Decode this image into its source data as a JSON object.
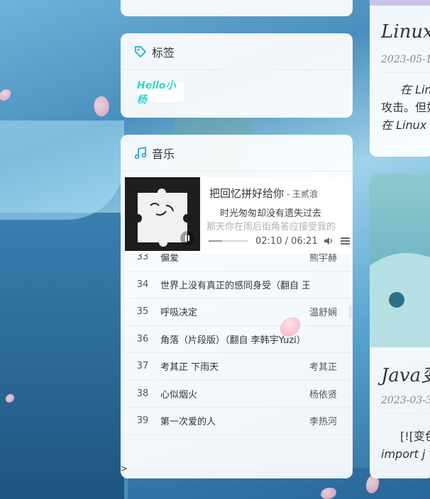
{
  "tags_card": {
    "title": "标签",
    "tags": [
      "Hello小杨"
    ]
  },
  "music_card": {
    "title": "音乐",
    "player": {
      "song": "把回忆拼好给你",
      "artist_sep": " - ",
      "artist": "王贰浪",
      "lyric_current": "时光匆匆却没有遗失过去",
      "lyric_next": "那天你在雨后街角答应接受我的",
      "time_current": "02:10",
      "time_sep": " / ",
      "time_total": "06:21",
      "progress": 0.34
    },
    "playlist": [
      {
        "num": "33",
        "name": "偏爱",
        "singer": "熊宇赫"
      },
      {
        "num": "34",
        "name": "世界上没有真正的感同身受（翻自 王",
        "singer": ""
      },
      {
        "num": "35",
        "name": "呼吸决定",
        "singer": "温舒娴"
      },
      {
        "num": "36",
        "name": "角落（片段版）（翻自 李韩宇Yuzi）",
        "singer": ""
      },
      {
        "num": "37",
        "name": "考其正 下雨天",
        "singer": "考其正"
      },
      {
        "num": "38",
        "name": "心似烟火",
        "singer": "杨依贤"
      },
      {
        "num": "39",
        "name": "第一次爱的人",
        "singer": "李热河"
      }
    ],
    "toggle_symbol": ">"
  },
  "right_posts": [
    {
      "title": "Linux",
      "date": "2023-05-1",
      "excerpt_lines": [
        "在 Lin",
        "攻击。但如",
        "在 Linux"
      ]
    },
    {
      "title": "Java变",
      "date": "2023-03-3",
      "excerpt_lines": [
        "[![变色",
        "import j"
      ]
    }
  ],
  "colors": {
    "accent": "#2aa6d6",
    "tag_text": "#2dd6c4"
  }
}
